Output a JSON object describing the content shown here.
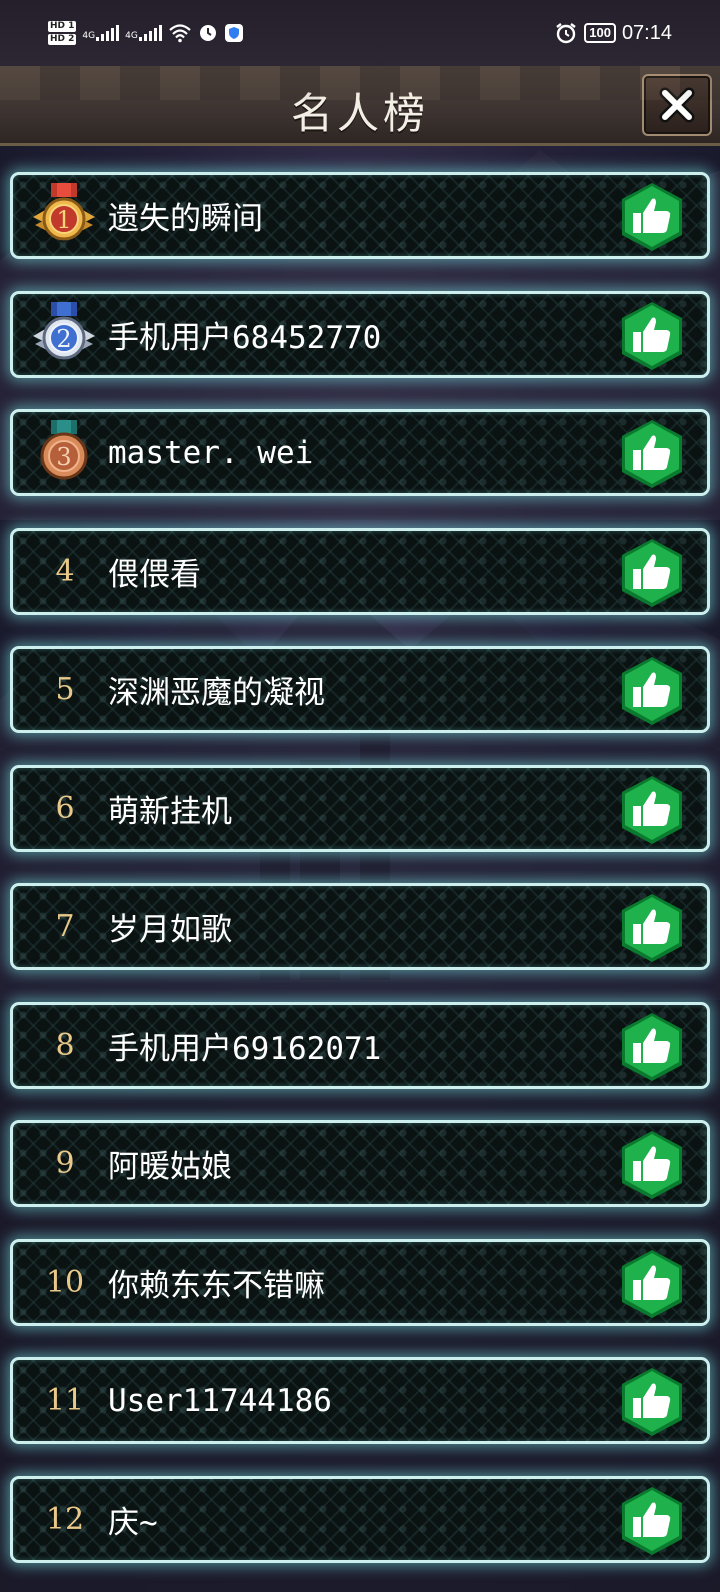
{
  "status_bar": {
    "hd1": "HD 1",
    "hd2": "HD 2",
    "net1": "4G",
    "net2": "4G",
    "battery": "100",
    "time": "07:14"
  },
  "header": {
    "title": "名人榜"
  },
  "icons": {
    "close": "close-icon",
    "like": "thumbs-up-icon",
    "medal_gold": "gold-medal-icon",
    "medal_silver": "silver-medal-icon",
    "medal_bronze": "bronze-medal-icon"
  },
  "colors": {
    "row_border": "#cdefee",
    "like_green": "#1fb14c",
    "rank_gold_text": "#e9c98a",
    "gold": "#e2a73a",
    "silver": "#3f6fd1",
    "bronze": "#c9744a"
  },
  "ranking": [
    {
      "rank": "1",
      "name": "遗失的瞬间",
      "medal": "gold"
    },
    {
      "rank": "2",
      "name": "手机用户68452770",
      "medal": "silver"
    },
    {
      "rank": "3",
      "name": "master. wei",
      "medal": "bronze"
    },
    {
      "rank": "4",
      "name": "偎偎看"
    },
    {
      "rank": "5",
      "name": "深渊恶魔的凝视"
    },
    {
      "rank": "6",
      "name": "萌新挂机"
    },
    {
      "rank": "7",
      "name": "岁月如歌"
    },
    {
      "rank": "8",
      "name": "手机用户69162071"
    },
    {
      "rank": "9",
      "name": "阿暖姑娘"
    },
    {
      "rank": "10",
      "name": "你赖东东不错嘛"
    },
    {
      "rank": "11",
      "name": "User11744186"
    },
    {
      "rank": "12",
      "name": "庆~"
    }
  ]
}
